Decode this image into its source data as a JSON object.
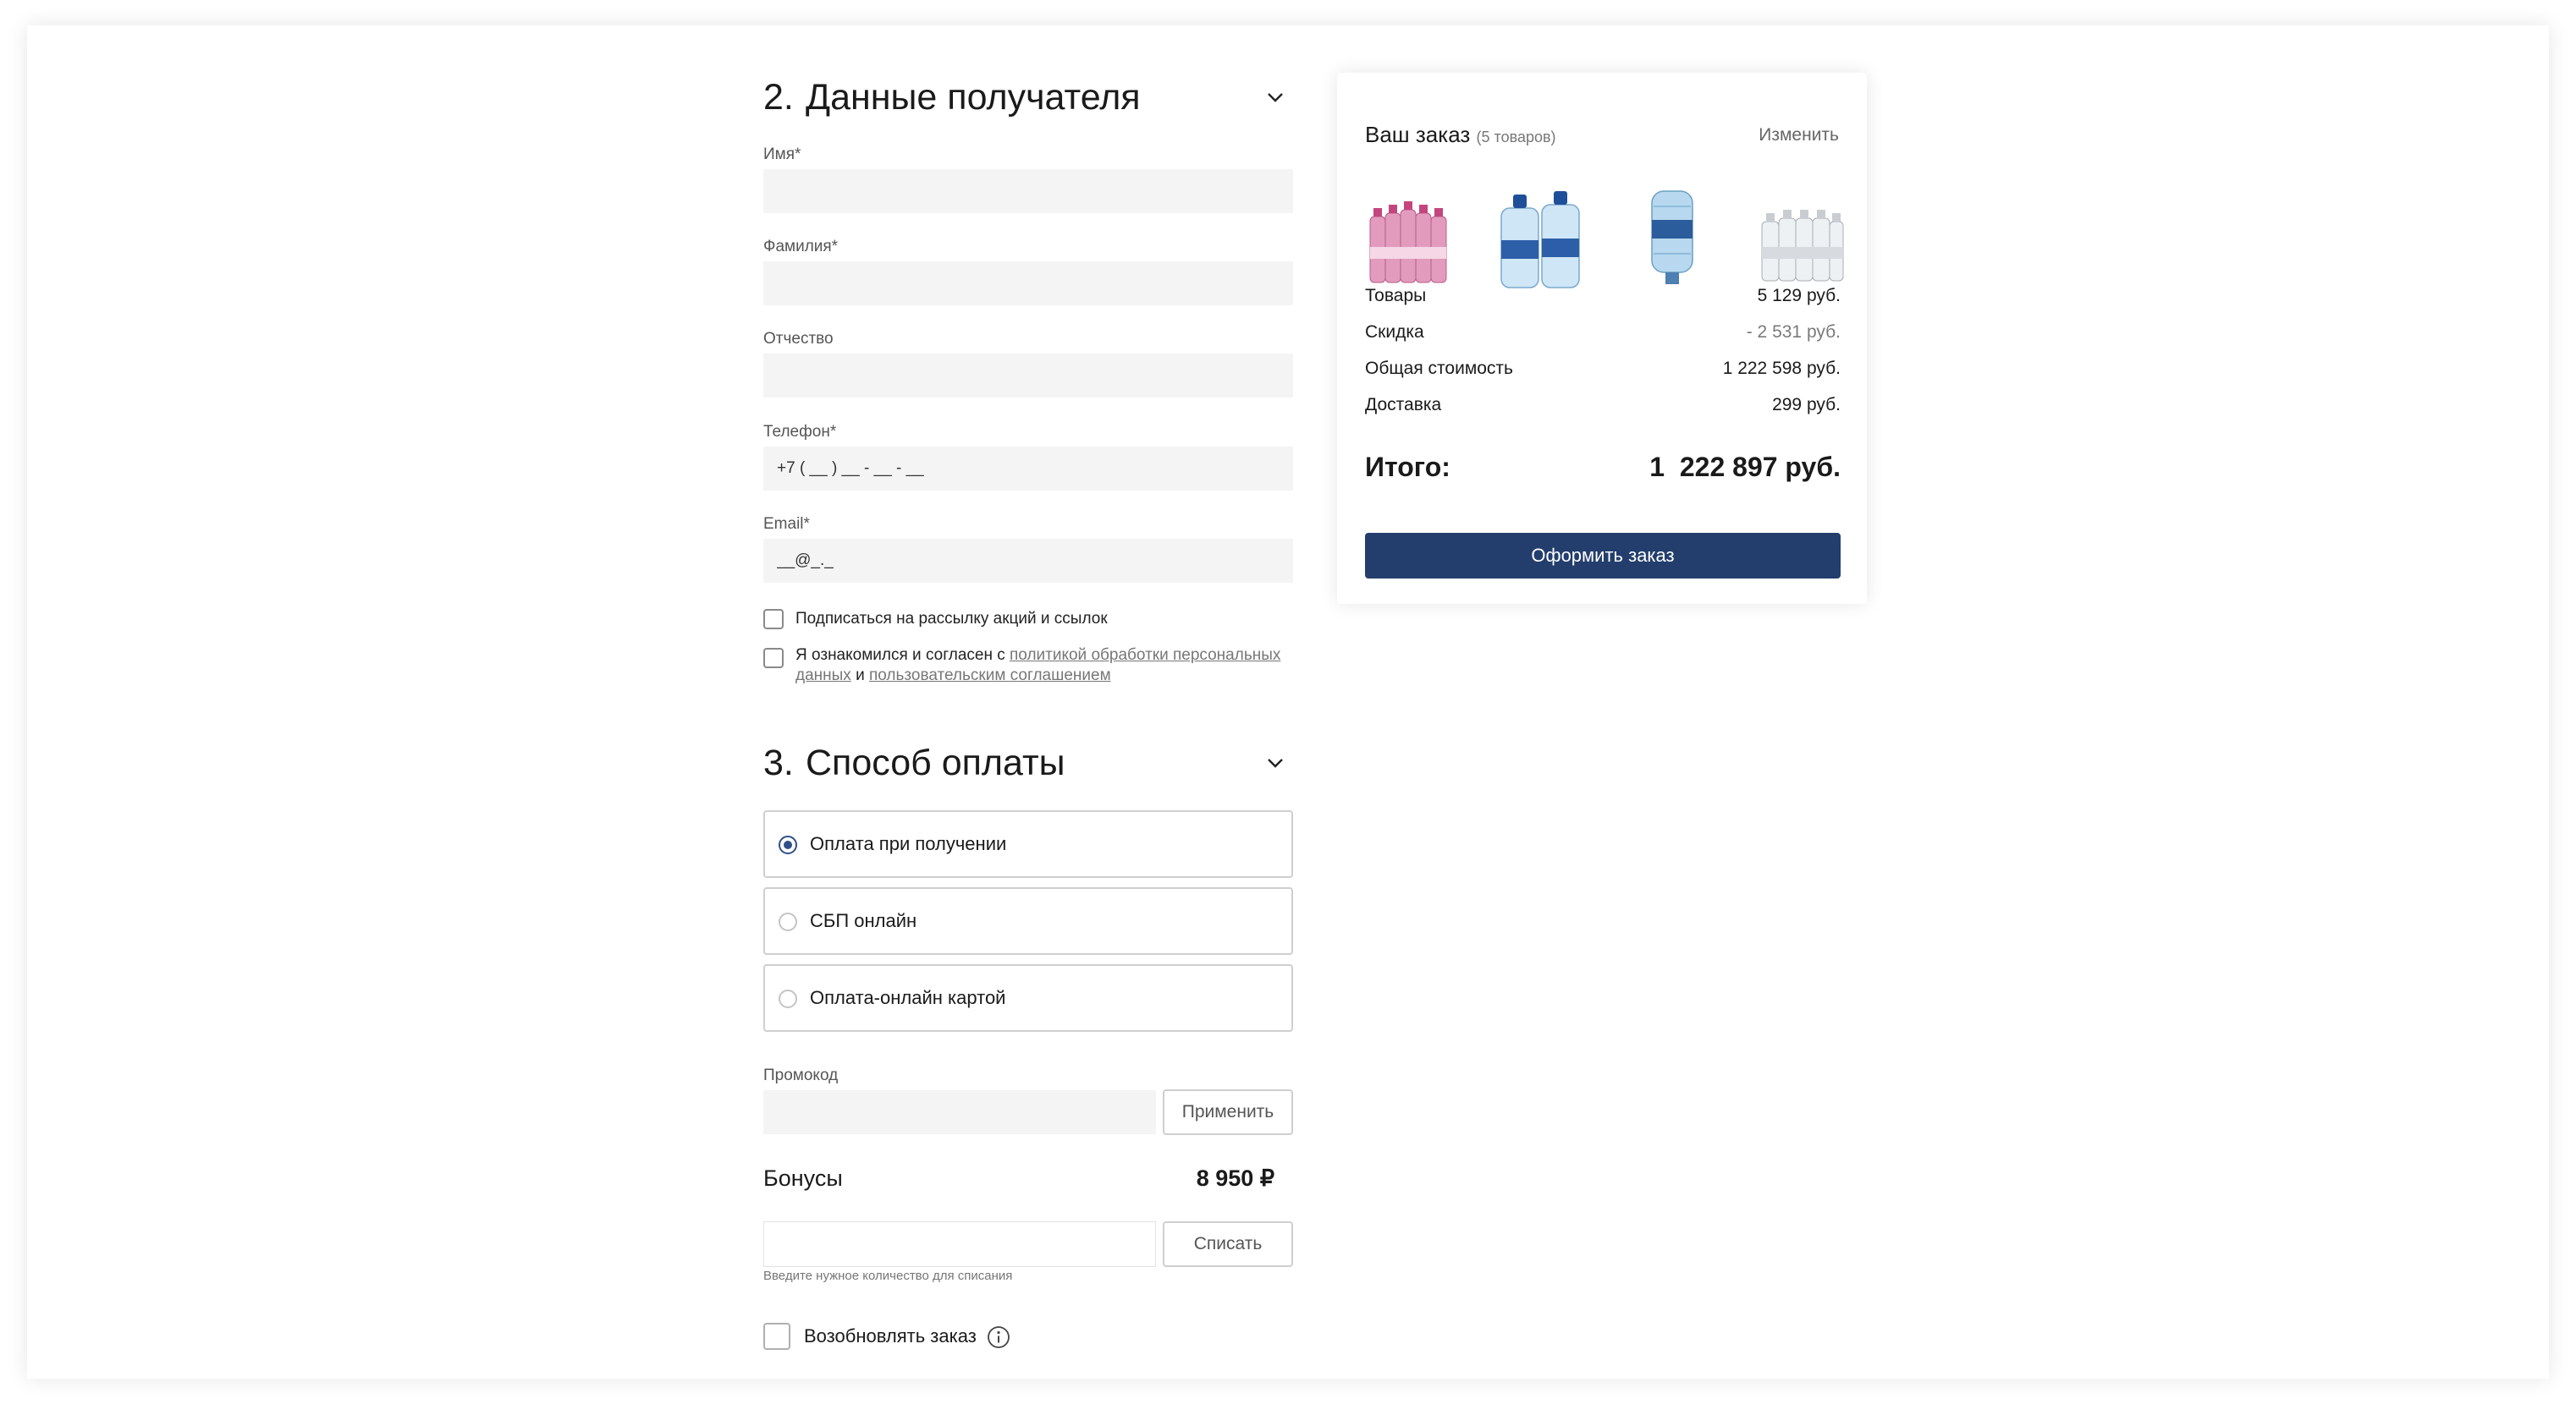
{
  "recipient": {
    "number": "2.",
    "title": "Данные получателя",
    "fields": {
      "first_name": {
        "label": "Имя*",
        "value": ""
      },
      "last_name": {
        "label": "Фамилия*",
        "value": ""
      },
      "patronymic": {
        "label": "Отчество",
        "value": ""
      },
      "phone": {
        "label": "Телефон*",
        "placeholder": "+7 ( __ ) __ - __ - __"
      },
      "email": {
        "label": "Email*",
        "placeholder": "__@_._"
      }
    },
    "subscribe_label": "Подписаться на рассылку акций и ссылок",
    "agree": {
      "prefix": "Я ознакомился и согласен с",
      "policy_link": "политикой обработки персональных данных",
      "and": "и",
      "terms_link": "пользовательским соглашением"
    }
  },
  "payment": {
    "number": "3.",
    "title": "Способ оплаты",
    "options": [
      {
        "label": "Оплата при получении",
        "selected": true
      },
      {
        "label": "СБП онлайн",
        "selected": false
      },
      {
        "label": "Оплата-онлайн картой",
        "selected": false
      }
    ],
    "promo": {
      "label": "Промокод",
      "value": "",
      "apply_label": "Применить"
    },
    "bonuses": {
      "label": "Бонусы",
      "amount": "8 950 ₽",
      "value": "",
      "writeoff_label": "Списать",
      "hint": "Введите нужное количество для списания"
    },
    "renew_label": "Возобновлять заказ"
  },
  "order": {
    "title": "Ваш заказ",
    "count": "(5 товаров)",
    "edit_label": "Изменить",
    "products": [
      "pink-water-pack",
      "blue-water-5l-pair",
      "water-cooler-bottle",
      "clear-water-pack"
    ],
    "rows": [
      {
        "label": "Товары",
        "value": "5 129 руб."
      },
      {
        "label": "Скидка",
        "value": "- 2 531 руб."
      },
      {
        "label": "Общая стоимость",
        "value": "1 222 598 руб."
      },
      {
        "label": "Доставка",
        "value": "299 руб."
      }
    ],
    "total": {
      "label": "Итого:",
      "value": "1  222 897 руб."
    },
    "submit_label": "Оформить заказ",
    "colors": {
      "accent": "#233e6d",
      "radio": "#2f4f88"
    }
  }
}
